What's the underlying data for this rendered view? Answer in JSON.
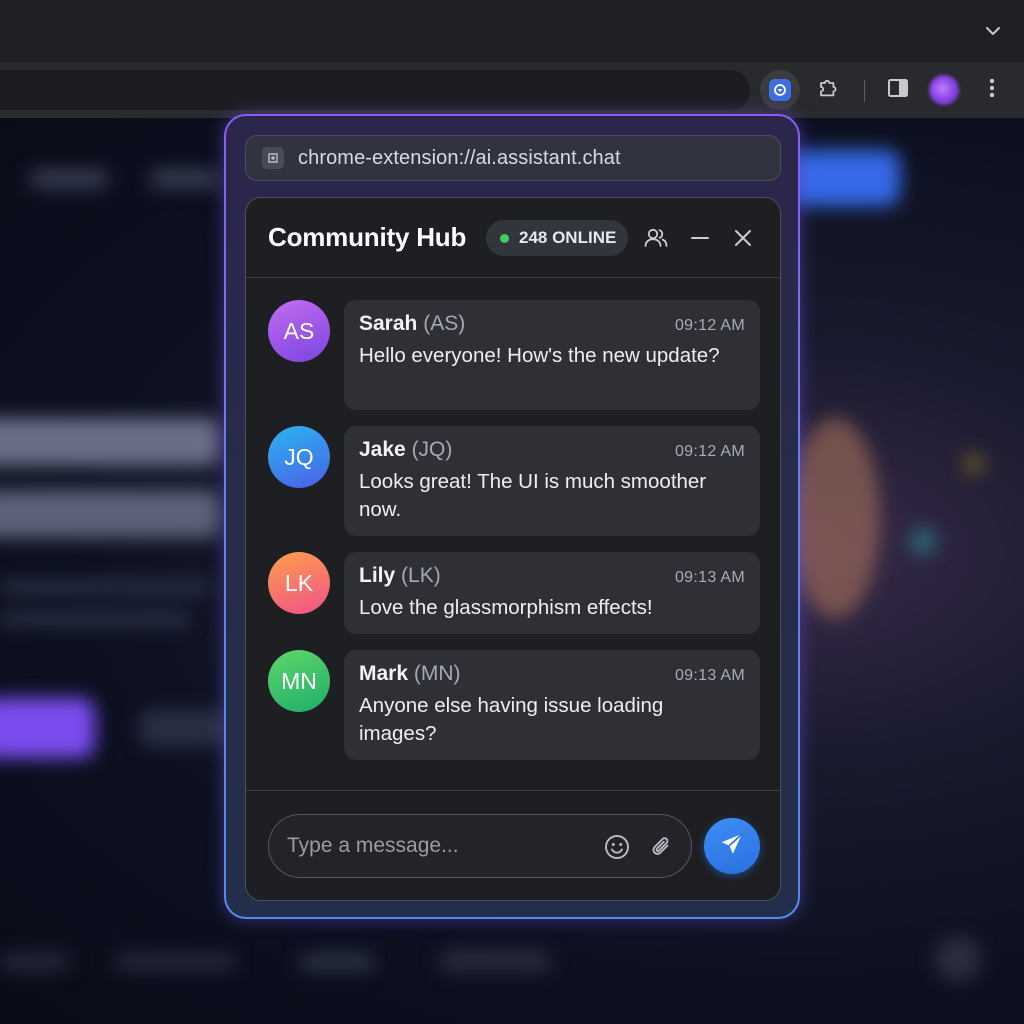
{
  "browser": {
    "toolbar_icons": [
      "active-extension-icon",
      "puzzle-icon",
      "side-panel-icon",
      "profile-avatar",
      "kebab-menu-icon"
    ],
    "tabstrip_icon": "chevron-down-icon"
  },
  "popup": {
    "url": "chrome-extension://ai.assistant.chat",
    "title": "Community Hub",
    "online_label": "248 ONLINE",
    "online_color": "#3ecf5a",
    "accent_gradient": [
      "#8a5cf6",
      "#4f8cf0"
    ]
  },
  "messages": [
    {
      "initials": "AS",
      "name": "Sarah",
      "name_initials": "(AS)",
      "time": "09:12 AM",
      "text": "Hello everyone! How's the new update?",
      "avatar_gradient": [
        "#c36cf0",
        "#7a45e0"
      ]
    },
    {
      "initials": "JQ",
      "name": "Jake",
      "name_initials": "(JQ)",
      "time": "09:12 AM",
      "text": "Looks great! The UI is much smoother now.",
      "avatar_gradient": [
        "#29b6f0",
        "#4b5fe8"
      ]
    },
    {
      "initials": "LK",
      "name": "Lily",
      "name_initials": "(LK)",
      "time": "09:13 AM",
      "text": "Love the glassmorphism effects!",
      "avatar_gradient": [
        "#ffa04a",
        "#f0508a"
      ]
    },
    {
      "initials": "MN",
      "name": "Mark",
      "name_initials": "(MN)",
      "time": "09:13 AM",
      "text": "Anyone else having issue loading images?",
      "avatar_gradient": [
        "#5fd66a",
        "#1fae6a"
      ]
    }
  ],
  "composer": {
    "placeholder": "Type a message...",
    "value": ""
  }
}
